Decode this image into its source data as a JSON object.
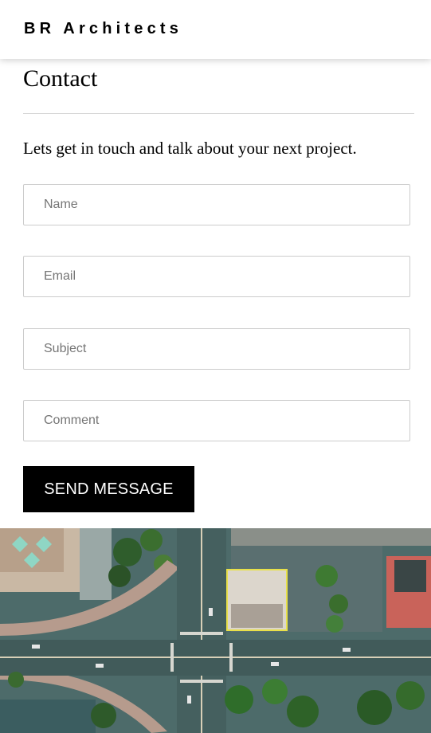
{
  "header": {
    "brand": "BR Architects"
  },
  "contact": {
    "title": "Contact",
    "intro": "Lets get in touch and talk about your next project."
  },
  "form": {
    "name_placeholder": "Name",
    "email_placeholder": "Email",
    "subject_placeholder": "Subject",
    "comment_placeholder": "Comment",
    "submit_label": "SEND MESSAGE"
  },
  "colors": {
    "button_background": "#000000",
    "button_text": "#ffffff",
    "field_border": "#cccccc",
    "divider": "#d6d6d6"
  }
}
